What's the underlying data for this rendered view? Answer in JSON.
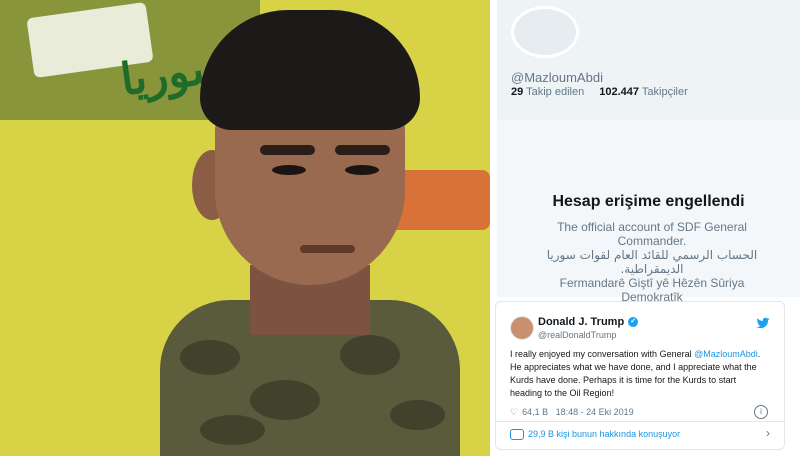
{
  "profile": {
    "handle": "@MazloumAbdi",
    "following_count": "29",
    "following_label": "Takip edilen",
    "followers_count": "102.447",
    "followers_label": "Takipçiler",
    "blocked_title": "Hesap erişime engellendi",
    "bio_en": "The official account of SDF General Commander.",
    "bio_ar": "الحساب الرسمي للقائد العام لقوات سوريا الديمقراطية.",
    "bio_ku": "Fermandarê Giştî yê Hêzên Sûriya Demokratîk"
  },
  "tweet": {
    "name": "Donald J. Trump",
    "handle": "@realDonaldTrump",
    "text_before": "I really enjoyed my conversation with General ",
    "mention": "@MazloumAbdi",
    "text_after": ". He appreciates what we have done, and I appreciate what the Kurds have done. Perhaps it is time for the Kurds to start heading to the Oil Region!",
    "likes": "64,1 B",
    "time": "18:48 - 24 Eki 2019",
    "footer": "29,9 B kişi bunun hakkında konuşuyor"
  },
  "photo": {
    "flag_text": "قوات سوريا"
  },
  "colors": {
    "twitter_blue": "#1da1f2",
    "mention_blue": "#1b95e0",
    "muted_text": "#657786",
    "flag_yellow": "#d8d247"
  },
  "icons": {
    "verified": "verified-badge-icon",
    "bird": "twitter-bird-icon",
    "heart": "heart-icon",
    "info": "info-icon",
    "chat": "chat-bubble-icon",
    "chevron": "chevron-right-icon"
  }
}
